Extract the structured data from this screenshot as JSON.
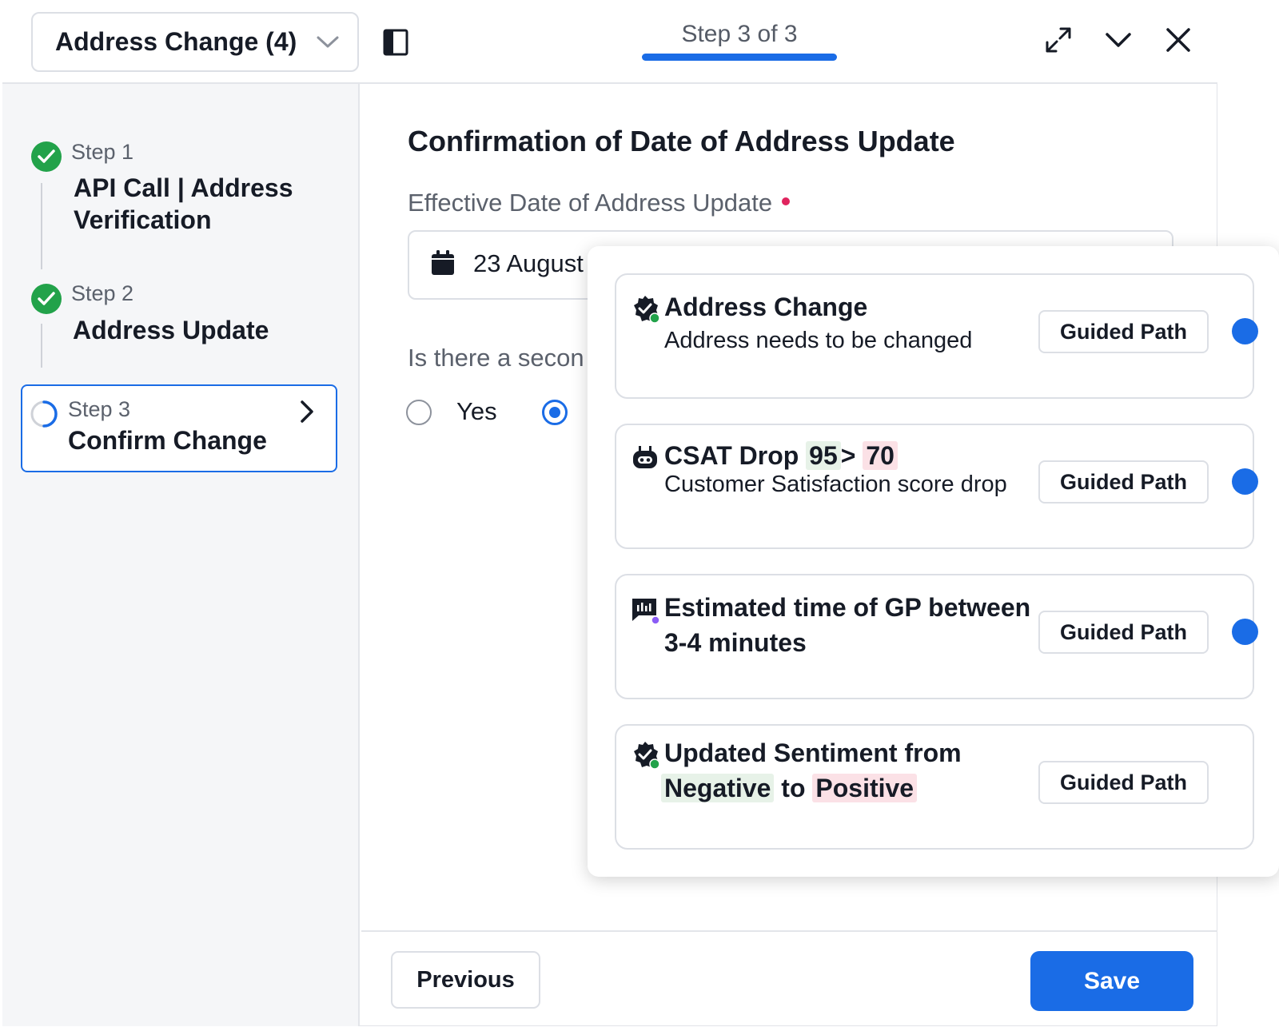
{
  "header": {
    "dropdown_label": "Address Change (4)",
    "step_indicator": "Step 3 of 3"
  },
  "sidebar": {
    "steps": [
      {
        "num": "Step 1",
        "title_line1": "API Call | Address",
        "title_line2": "Verification",
        "status": "complete"
      },
      {
        "num": "Step 2",
        "title_line1": "Address Update",
        "status": "complete"
      },
      {
        "num": "Step 3",
        "title_line1": "Confirm Change",
        "status": "in-progress"
      }
    ]
  },
  "main": {
    "title": "Confirmation of Date of Address Update",
    "field_label": "Effective Date of Address Update",
    "date_value": "23 August",
    "question": "Is there a secon",
    "radio_yes": "Yes"
  },
  "footer": {
    "previous_label": "Previous",
    "save_label": "Save"
  },
  "popover": {
    "cards": [
      {
        "icon": "verified-badge-icon",
        "title": "Address Change",
        "subtitle": "Address needs to be changed",
        "button": "Guided Path",
        "dot": true
      },
      {
        "icon": "robot-icon",
        "title_prefix": "CSAT Drop",
        "from": "95",
        "arrow": ">",
        "to": "70",
        "subtitle": "Customer Satisfaction score drop",
        "button": "Guided Path",
        "dot": true
      },
      {
        "icon": "chart-message-icon",
        "title_line1": "Estimated time of GP between",
        "title_line2": "3-4 minutes",
        "button": "Guided Path",
        "dot": true
      },
      {
        "icon": "verified-badge-icon",
        "title_line1": "Updated Sentiment from",
        "from": "Negative",
        "connector": "to",
        "to": "Positive",
        "button": "Guided Path",
        "dot": false
      }
    ]
  },
  "colors": {
    "accent": "#1a6ce6",
    "success": "#22a24a",
    "required": "#e0245e"
  }
}
